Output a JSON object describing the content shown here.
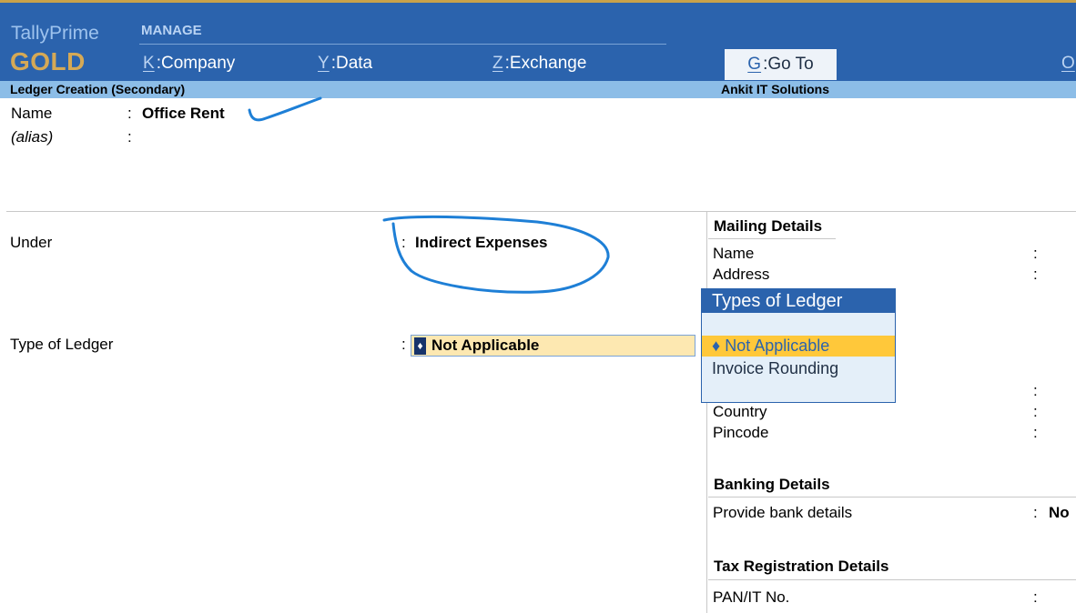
{
  "brand": {
    "product": "TallyPrime",
    "edition": "GOLD"
  },
  "menu": {
    "section": "MANAGE",
    "items": [
      {
        "key": "K",
        "label": "Company"
      },
      {
        "key": "Y",
        "label": "Data"
      },
      {
        "key": "Z",
        "label": "Exchange"
      }
    ],
    "goto": {
      "key": "G",
      "label": "Go To"
    },
    "edge_key": "O"
  },
  "screen": {
    "title": "Ledger Creation (Secondary)",
    "company": "Ankit IT Solutions"
  },
  "form": {
    "name_label": "Name",
    "name_value": "Office Rent",
    "alias_label": "(alias)",
    "colon": ":",
    "under_label": "Under",
    "under_value": "Indirect Expenses",
    "type_label": "Type of Ledger",
    "type_value": "Not Applicable"
  },
  "mailing": {
    "title": "Mailing Details",
    "name_label": "Name",
    "address_label": "Address",
    "country_label": "Country",
    "pincode_label": "Pincode"
  },
  "banking": {
    "title": "Banking Details",
    "provide_label": "Provide bank details",
    "provide_value": "No"
  },
  "tax": {
    "title": "Tax Registration Details",
    "pan_label": "PAN/IT No."
  },
  "popup": {
    "title": "Types of Ledger",
    "options": [
      {
        "label": "Not Applicable",
        "bullet": "♦",
        "selected": true
      },
      {
        "label": "Invoice Rounding",
        "selected": false
      }
    ]
  },
  "colors": {
    "header": "#2b63ad",
    "subbar": "#8cbde7",
    "highlight": "#ffc83a",
    "field": "#fde8b1",
    "annotation": "#1e7fd6"
  }
}
